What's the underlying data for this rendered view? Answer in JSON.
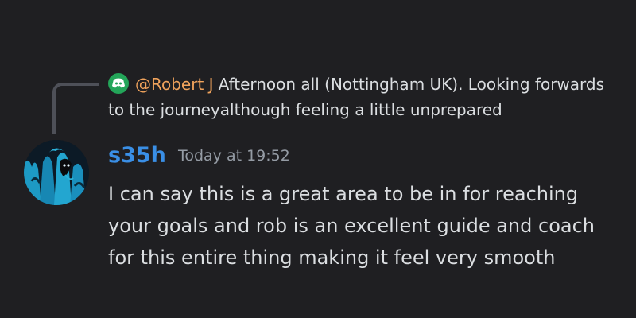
{
  "reply": {
    "author": "@Robert J",
    "text": "Afternoon all (Nottingham UK). Looking forwards to the journeyalthough feeling a little unprepared",
    "avatar_icon": "discord-logo-icon",
    "avatar_color": "#23a559"
  },
  "message": {
    "username": "s35h",
    "timestamp": "Today at 19:52",
    "body": "I can say this is a great area to be in for reaching your goals and rob is an excellent guide and coach for this entire thing making it feel very smooth"
  },
  "colors": {
    "background": "#1f1f22",
    "reply_author": "#f0a35c",
    "username": "#3a8fe6",
    "text": "#dbdee1",
    "timestamp": "#949ba4"
  }
}
